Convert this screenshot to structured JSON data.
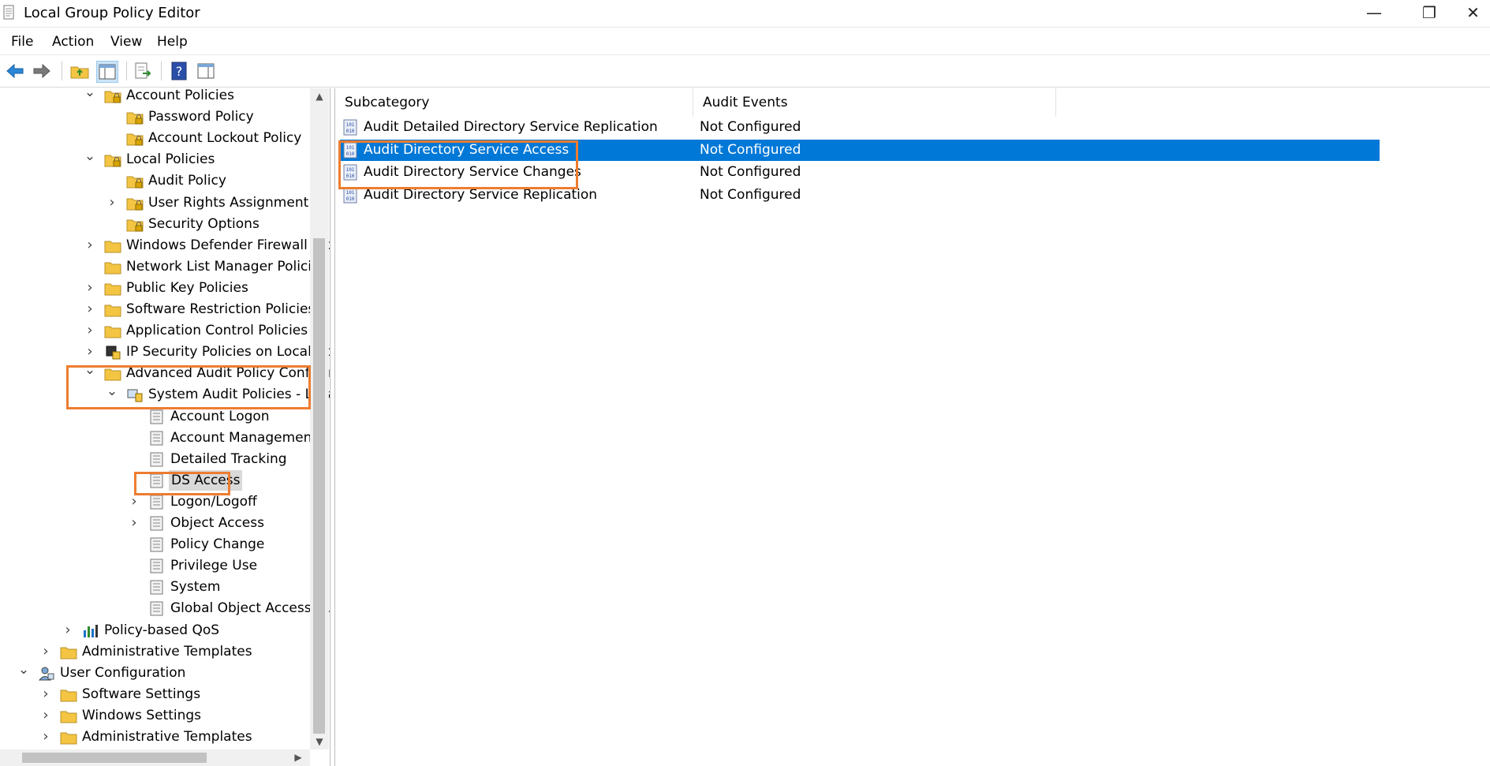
{
  "window": {
    "title": "Local Group Policy Editor",
    "minimize_glyph": "—",
    "restore_glyph": "❐",
    "close_glyph": "✕"
  },
  "menu": [
    "File",
    "Action",
    "View",
    "Help"
  ],
  "toolbar": {
    "buttons": [
      "back-icon",
      "forward-icon",
      "up-folder-icon",
      "show-hide-tree-icon",
      "export-list-icon",
      "help-icon",
      "show-hide-action-pane-icon"
    ]
  },
  "tree": {
    "items": [
      {
        "label": "Account Policies",
        "expander": "expanded",
        "icon": "locked-folder-icon"
      },
      {
        "label": "Password Policy",
        "expander": "none",
        "icon": "locked-folder-icon"
      },
      {
        "label": "Account Lockout Policy",
        "expander": "none",
        "icon": "locked-folder-icon"
      },
      {
        "label": "Local Policies",
        "expander": "expanded",
        "icon": "locked-folder-icon"
      },
      {
        "label": "Audit Policy",
        "expander": "none",
        "icon": "locked-folder-icon"
      },
      {
        "label": "User Rights Assignment",
        "expander": "collapsed",
        "icon": "locked-folder-icon"
      },
      {
        "label": "Security Options",
        "expander": "none",
        "icon": "locked-folder-icon"
      },
      {
        "label": "Windows Defender Firewall wit",
        "expander": "collapsed",
        "icon": "folder-icon"
      },
      {
        "label": "Network List Manager Policies",
        "expander": "none",
        "icon": "folder-icon"
      },
      {
        "label": "Public Key Policies",
        "expander": "collapsed",
        "icon": "folder-icon"
      },
      {
        "label": "Software Restriction Policies",
        "expander": "collapsed",
        "icon": "folder-icon"
      },
      {
        "label": "Application Control Policies",
        "expander": "collapsed",
        "icon": "folder-icon"
      },
      {
        "label": "IP Security Policies on Local Co",
        "expander": "collapsed",
        "icon": "ip-security-icon"
      },
      {
        "label": "Advanced Audit Policy Configu",
        "expander": "expanded",
        "icon": "folder-icon"
      },
      {
        "label": "System Audit Policies - Loca",
        "expander": "expanded",
        "icon": "computer-policy-icon"
      },
      {
        "label": "Account Logon",
        "expander": "none",
        "icon": "policy-list-icon"
      },
      {
        "label": "Account Management",
        "expander": "none",
        "icon": "policy-list-icon"
      },
      {
        "label": "Detailed Tracking",
        "expander": "none",
        "icon": "policy-list-icon"
      },
      {
        "label": "DS Access",
        "expander": "none",
        "icon": "policy-list-icon"
      },
      {
        "label": "Logon/Logoff",
        "expander": "collapsed",
        "icon": "policy-list-icon"
      },
      {
        "label": "Object Access",
        "expander": "collapsed",
        "icon": "policy-list-icon"
      },
      {
        "label": "Policy Change",
        "expander": "none",
        "icon": "policy-list-icon"
      },
      {
        "label": "Privilege Use",
        "expander": "none",
        "icon": "policy-list-icon"
      },
      {
        "label": "System",
        "expander": "none",
        "icon": "policy-list-icon"
      },
      {
        "label": "Global Object Access Au",
        "expander": "none",
        "icon": "policy-list-icon"
      },
      {
        "label": "Policy-based QoS",
        "expander": "collapsed",
        "icon": "bar-chart-icon"
      },
      {
        "label": "Administrative Templates",
        "expander": "collapsed",
        "icon": "folder-icon"
      },
      {
        "label": "User Configuration",
        "expander": "expanded",
        "icon": "user-config-icon"
      },
      {
        "label": "Software Settings",
        "expander": "collapsed",
        "icon": "folder-icon"
      },
      {
        "label": "Windows Settings",
        "expander": "collapsed",
        "icon": "folder-icon"
      },
      {
        "label": "Administrative Templates",
        "expander": "collapsed",
        "icon": "folder-icon"
      }
    ],
    "selected": "DS Access"
  },
  "details": {
    "columns": [
      "Subcategory",
      "Audit Events"
    ],
    "rows": [
      {
        "subcategory": "Audit Detailed Directory Service Replication",
        "audit_events": "Not Configured"
      },
      {
        "subcategory": "Audit Directory Service Access",
        "audit_events": "Not Configured",
        "selected": true
      },
      {
        "subcategory": "Audit Directory Service Changes",
        "audit_events": "Not Configured"
      },
      {
        "subcategory": "Audit Directory Service Replication",
        "audit_events": "Not Configured"
      }
    ]
  },
  "colors": {
    "selection": "#0078d7",
    "highlight_box": "#ed7d31",
    "folder": "#f4c542"
  }
}
